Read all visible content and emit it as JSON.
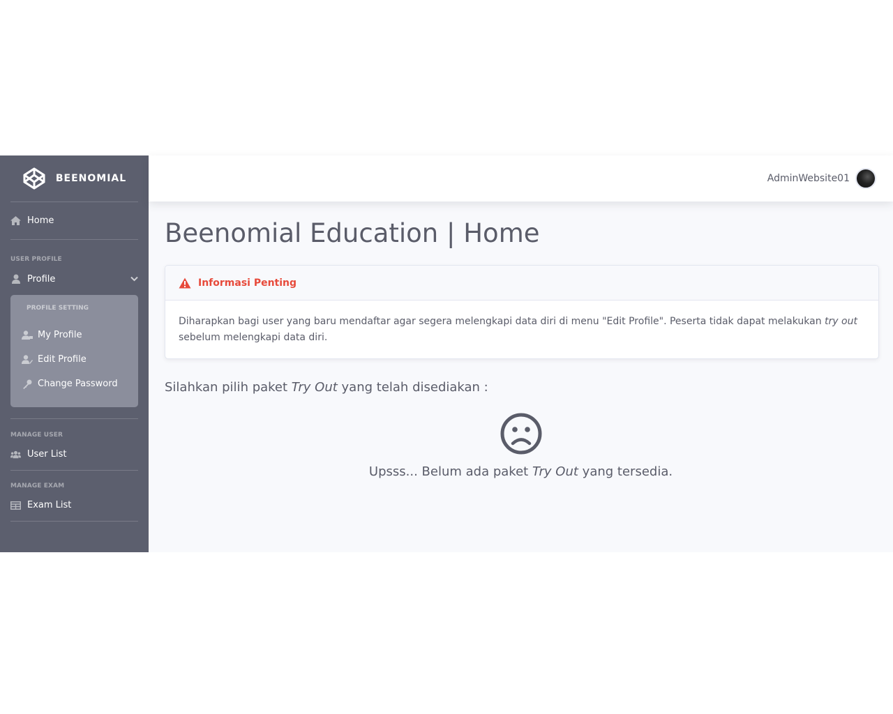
{
  "sidebar": {
    "brand": "BEENOMIAL",
    "home_label": "Home",
    "heading_user_profile": "USER PROFILE",
    "profile_label": "Profile",
    "profile_setting_heading": "PROFILE SETTING",
    "profile_items": [
      {
        "label": "My Profile",
        "icon": "user-icon"
      },
      {
        "label": "Edit Profile",
        "icon": "user-edit-icon"
      },
      {
        "label": "Change Password",
        "icon": "key-icon"
      }
    ],
    "heading_manage_user": "MANAGE USER",
    "user_list_label": "User List",
    "heading_manage_exam": "MANAGE EXAM",
    "exam_list_label": "Exam List"
  },
  "topbar": {
    "username": "AdminWebsite01"
  },
  "main": {
    "page_title": "Beenomial Education | Home",
    "alert": {
      "title": "Informasi Penting",
      "body_part1": "Diharapkan bagi user yang baru mendaftar agar segera melengkapi data diri di menu \"Edit Profile\". Peserta tidak dapat melakukan ",
      "body_italic": "try out",
      "body_part2": " sebelum melengkapi data diri."
    },
    "pick_prefix": "Silahkan pilih paket ",
    "pick_italic": "Try Out",
    "pick_suffix": " yang telah disediakan :",
    "empty_prefix": "Upsss... Belum ada paket ",
    "empty_italic": "Try Out",
    "empty_suffix": " yang tersedia."
  },
  "colors": {
    "sidebar_bg": "#5c5f6e",
    "collapse_bg": "#8b8e9c",
    "alert_red": "#e74a3b",
    "text": "#5a5c69"
  }
}
